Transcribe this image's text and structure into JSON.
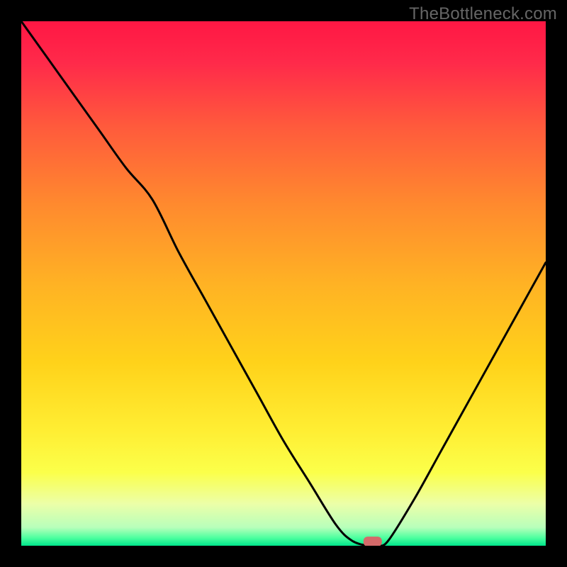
{
  "watermark": "TheBottleneck.com",
  "chart_data": {
    "type": "line",
    "title": "",
    "xlabel": "",
    "ylabel": "",
    "xlim": [
      0,
      100
    ],
    "ylim": [
      0,
      100
    ],
    "grid": false,
    "series": [
      {
        "name": "curve",
        "x": [
          0,
          5,
          10,
          15,
          20,
          25,
          30,
          35,
          40,
          45,
          50,
          55,
          60,
          63,
          66,
          68,
          70,
          75,
          80,
          85,
          90,
          95,
          100
        ],
        "y": [
          100,
          93,
          86,
          79,
          72,
          66,
          56,
          47,
          38,
          29,
          20,
          12,
          4,
          1,
          0,
          0,
          1,
          9,
          18,
          27,
          36,
          45,
          54
        ]
      }
    ],
    "marker": {
      "x": 67,
      "y": 0.8,
      "color": "#d46a6a"
    },
    "gradient_stops": [
      {
        "pos": 0.0,
        "color": "#ff1744"
      },
      {
        "pos": 0.08,
        "color": "#ff2a4a"
      },
      {
        "pos": 0.2,
        "color": "#ff5a3c"
      },
      {
        "pos": 0.35,
        "color": "#ff8a2e"
      },
      {
        "pos": 0.5,
        "color": "#ffb224"
      },
      {
        "pos": 0.65,
        "color": "#ffd21a"
      },
      {
        "pos": 0.78,
        "color": "#ffee33"
      },
      {
        "pos": 0.86,
        "color": "#fbff4a"
      },
      {
        "pos": 0.92,
        "color": "#ecffa8"
      },
      {
        "pos": 0.965,
        "color": "#b8ffbb"
      },
      {
        "pos": 0.985,
        "color": "#4cff9f"
      },
      {
        "pos": 1.0,
        "color": "#00e58b"
      }
    ]
  }
}
